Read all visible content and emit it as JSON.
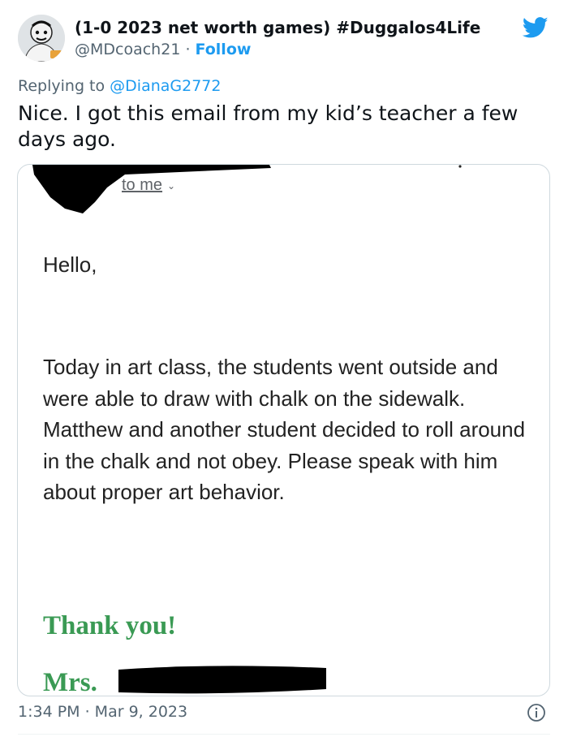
{
  "tweet": {
    "display_name": "(1-0 2023 net worth games) #Duggalos4Life",
    "handle": "@MDcoach21",
    "separator": " · ",
    "follow_label": "Follow",
    "replying_prefix": "Replying to ",
    "replying_to": "@DianaG2772",
    "text": "Nice. I got this email from my kid’s teacher a few days ago.",
    "timestamp": "1:34 PM · Mar 9, 2023"
  },
  "email": {
    "recipient_label": "to me",
    "greeting": "Hello,",
    "body": "Today in art class, the students went outside and were able to draw with chalk on the sidewalk. Matthew and another student decided to roll around in the chalk and not obey. Please speak with him about proper art behavior.",
    "thanks": "Thank you!",
    "signature_prefix": "Mrs."
  },
  "colors": {
    "twitter_blue": "#1d9bf0",
    "secondary_text": "#536471",
    "signature_green": "#3a9a54",
    "redaction": "#000000"
  },
  "icons": {
    "brand": "twitter-bird-icon",
    "info": "info-icon",
    "chevron": "chevron-down-icon"
  }
}
